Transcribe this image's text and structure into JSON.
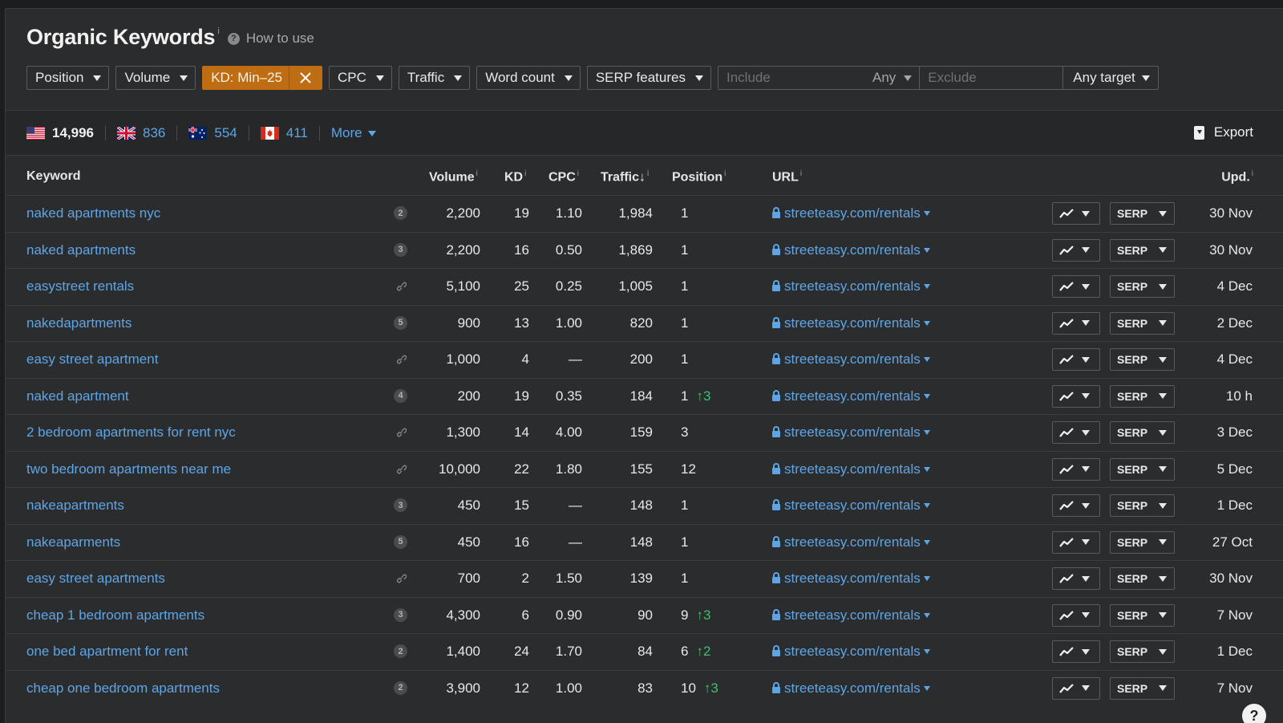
{
  "header": {
    "title": "Organic Keywords",
    "title_info": "i",
    "how_to_use": "How to use"
  },
  "filters": {
    "position": "Position",
    "volume": "Volume",
    "kd_active": "KD: Min–25",
    "cpc": "CPC",
    "traffic": "Traffic",
    "word_count": "Word count",
    "serp_features": "SERP features",
    "include_placeholder": "Include",
    "any": "Any",
    "exclude_placeholder": "Exclude",
    "any_target": "Any target"
  },
  "countries": {
    "us": "14,996",
    "gb": "836",
    "au": "554",
    "ca": "411",
    "more": "More",
    "export": "Export"
  },
  "columns": {
    "keyword": "Keyword",
    "volume": "Volume",
    "kd": "KD",
    "cpc": "CPC",
    "traffic": "Traffic",
    "traffic_sort": "↓",
    "position": "Position",
    "url": "URL",
    "updated": "Upd.",
    "info": "i"
  },
  "row_buttons": {
    "serp": "SERP"
  },
  "rows": [
    {
      "keyword": "naked apartments nyc",
      "badge": "2",
      "volume": "2,200",
      "kd": "19",
      "cpc": "1.10",
      "traffic": "1,984",
      "position": "1",
      "change": "",
      "url": "streeteasy.com/rentals",
      "updated": "30 Nov"
    },
    {
      "keyword": "naked apartments",
      "badge": "3",
      "volume": "2,200",
      "kd": "16",
      "cpc": "0.50",
      "traffic": "1,869",
      "position": "1",
      "change": "",
      "url": "streeteasy.com/rentals",
      "updated": "30 Nov"
    },
    {
      "keyword": "easystreet rentals",
      "badge": "",
      "volume": "5,100",
      "kd": "25",
      "cpc": "0.25",
      "traffic": "1,005",
      "position": "1",
      "change": "",
      "url": "streeteasy.com/rentals",
      "updated": "4 Dec"
    },
    {
      "keyword": "nakedapartments",
      "badge": "5",
      "volume": "900",
      "kd": "13",
      "cpc": "1.00",
      "traffic": "820",
      "position": "1",
      "change": "",
      "url": "streeteasy.com/rentals",
      "updated": "2 Dec"
    },
    {
      "keyword": "easy street apartment",
      "badge": "",
      "volume": "1,000",
      "kd": "4",
      "cpc": "—",
      "traffic": "200",
      "position": "1",
      "change": "",
      "url": "streeteasy.com/rentals",
      "updated": "4 Dec"
    },
    {
      "keyword": "naked apartment",
      "badge": "4",
      "volume": "200",
      "kd": "19",
      "cpc": "0.35",
      "traffic": "184",
      "position": "1",
      "change": "↑3",
      "url": "streeteasy.com/rentals",
      "updated": "10 h"
    },
    {
      "keyword": "2 bedroom apartments for rent nyc",
      "badge": "",
      "volume": "1,300",
      "kd": "14",
      "cpc": "4.00",
      "traffic": "159",
      "position": "3",
      "change": "",
      "url": "streeteasy.com/rentals",
      "updated": "3 Dec"
    },
    {
      "keyword": "two bedroom apartments near me",
      "badge": "",
      "volume": "10,000",
      "kd": "22",
      "cpc": "1.80",
      "traffic": "155",
      "position": "12",
      "change": "",
      "url": "streeteasy.com/rentals",
      "updated": "5 Dec"
    },
    {
      "keyword": "nakeapartments",
      "badge": "3",
      "volume": "450",
      "kd": "15",
      "cpc": "—",
      "traffic": "148",
      "position": "1",
      "change": "",
      "url": "streeteasy.com/rentals",
      "updated": "1 Dec"
    },
    {
      "keyword": "nakeaparments",
      "badge": "5",
      "volume": "450",
      "kd": "16",
      "cpc": "—",
      "traffic": "148",
      "position": "1",
      "change": "",
      "url": "streeteasy.com/rentals",
      "updated": "27 Oct"
    },
    {
      "keyword": "easy street apartments",
      "badge": "",
      "volume": "700",
      "kd": "2",
      "cpc": "1.50",
      "traffic": "139",
      "position": "1",
      "change": "",
      "url": "streeteasy.com/rentals",
      "updated": "30 Nov"
    },
    {
      "keyword": "cheap 1 bedroom apartments",
      "badge": "3",
      "volume": "4,300",
      "kd": "6",
      "cpc": "0.90",
      "traffic": "90",
      "position": "9",
      "change": "↑3",
      "url": "streeteasy.com/rentals",
      "updated": "7 Nov"
    },
    {
      "keyword": "one bed apartment for rent",
      "badge": "2",
      "volume": "1,400",
      "kd": "24",
      "cpc": "1.70",
      "traffic": "84",
      "position": "6",
      "change": "↑2",
      "url": "streeteasy.com/rentals",
      "updated": "1 Dec"
    },
    {
      "keyword": "cheap one bedroom apartments",
      "badge": "2",
      "volume": "3,900",
      "kd": "12",
      "cpc": "1.00",
      "traffic": "83",
      "position": "10",
      "change": "↑3",
      "url": "streeteasy.com/rentals",
      "updated": "7 Nov"
    }
  ],
  "help": "?"
}
